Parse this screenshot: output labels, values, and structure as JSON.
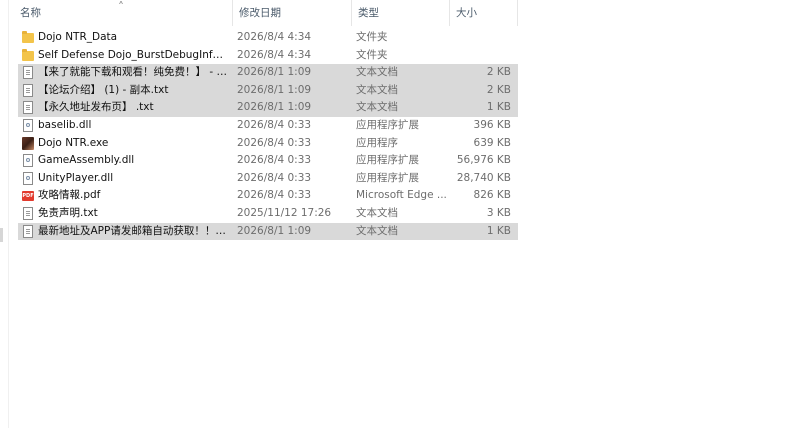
{
  "columns": {
    "name": "名称",
    "date": "修改日期",
    "type": "类型",
    "size": "大小"
  },
  "files": [
    {
      "name": "Dojo NTR_Data",
      "date": "2026/8/4 4:34",
      "type": "文件夹",
      "size": "",
      "icon": "folder-icon",
      "selected": false
    },
    {
      "name": "Self Defense Dojo_BurstDebugInform...",
      "date": "2026/8/4 4:34",
      "type": "文件夹",
      "size": "",
      "icon": "folder-icon",
      "selected": false
    },
    {
      "name": "【来了就能下载和观看！纯免费！】 - 副...",
      "date": "2026/8/1 1:09",
      "type": "文本文档",
      "size": "2 KB",
      "icon": "text-file-icon",
      "selected": true
    },
    {
      "name": "【论坛介绍】 (1) - 副本.txt",
      "date": "2026/8/1 1:09",
      "type": "文本文档",
      "size": "2 KB",
      "icon": "text-file-icon",
      "selected": true
    },
    {
      "name": "【永久地址发布页】 .txt",
      "date": "2026/8/1 1:09",
      "type": "文本文档",
      "size": "1 KB",
      "icon": "text-file-icon",
      "selected": true
    },
    {
      "name": "baselib.dll",
      "date": "2026/8/4 0:33",
      "type": "应用程序扩展",
      "size": "396 KB",
      "icon": "dll-file-icon",
      "selected": false
    },
    {
      "name": "Dojo NTR.exe",
      "date": "2026/8/4 0:33",
      "type": "应用程序",
      "size": "639 KB",
      "icon": "exe-file-icon",
      "selected": false
    },
    {
      "name": "GameAssembly.dll",
      "date": "2026/8/4 0:33",
      "type": "应用程序扩展",
      "size": "56,976 KB",
      "icon": "dll-file-icon",
      "selected": false
    },
    {
      "name": "UnityPlayer.dll",
      "date": "2026/8/4 0:33",
      "type": "应用程序扩展",
      "size": "28,740 KB",
      "icon": "dll-file-icon",
      "selected": false
    },
    {
      "name": "攻略情報.pdf",
      "date": "2026/8/4 0:33",
      "type": "Microsoft Edge ...",
      "size": "826 KB",
      "icon": "pdf-file-icon",
      "selected": false
    },
    {
      "name": "免责声明.txt",
      "date": "2025/11/12 17:26",
      "type": "文本文档",
      "size": "3 KB",
      "icon": "text-file-icon",
      "selected": false
    },
    {
      "name": "最新地址及APP请发邮箱自动获取！！！...",
      "date": "2026/8/1 1:09",
      "type": "文本文档",
      "size": "1 KB",
      "icon": "text-file-icon",
      "selected": true
    }
  ],
  "pdf_badge": "PDF"
}
